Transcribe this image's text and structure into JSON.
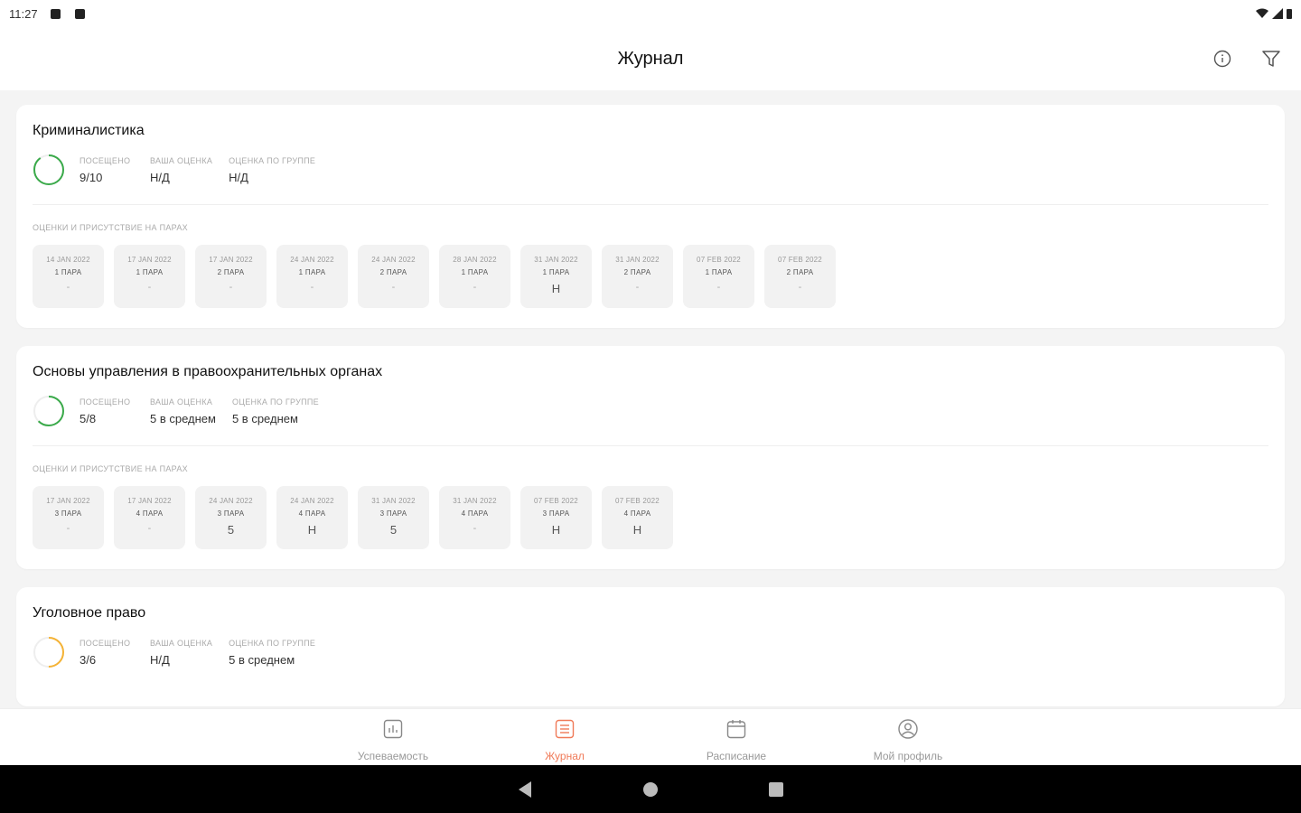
{
  "status_bar": {
    "time": "11:27"
  },
  "header": {
    "title": "Журнал",
    "info_icon": "info-icon",
    "filter_icon": "filter-icon"
  },
  "colors": {
    "accent": "#f07a58",
    "green": "#3aaa4a",
    "orange": "#f5b335"
  },
  "subjects": [
    {
      "title": "Криминалистика",
      "ring_color": "#3aaa4a",
      "attendance_fraction": 0.9,
      "stats": [
        {
          "label": "Посещено",
          "value": "9/10"
        },
        {
          "label": "Ваша оценка",
          "value": "Н/Д"
        },
        {
          "label": "Оценка по группе",
          "value": "Н/Д"
        }
      ],
      "section_label": "Оценки и присутствие на парах",
      "grades": [
        {
          "date": "14 JAN 2022",
          "pair": "1 ПАРА",
          "mark": "-"
        },
        {
          "date": "17 JAN 2022",
          "pair": "1 ПАРА",
          "mark": "-"
        },
        {
          "date": "17 JAN 2022",
          "pair": "2 ПАРА",
          "mark": "-"
        },
        {
          "date": "24 JAN 2022",
          "pair": "1 ПАРА",
          "mark": "-"
        },
        {
          "date": "24 JAN 2022",
          "pair": "2 ПАРА",
          "mark": "-"
        },
        {
          "date": "28 JAN 2022",
          "pair": "1 ПАРА",
          "mark": "-"
        },
        {
          "date": "31 JAN 2022",
          "pair": "1 ПАРА",
          "mark": "Н"
        },
        {
          "date": "31 JAN 2022",
          "pair": "2 ПАРА",
          "mark": "-"
        },
        {
          "date": "07 FEB 2022",
          "pair": "1 ПАРА",
          "mark": "-"
        },
        {
          "date": "07 FEB 2022",
          "pair": "2 ПАРА",
          "mark": "-"
        }
      ]
    },
    {
      "title": "Основы управления в правоохранительных органах",
      "ring_color": "#3aaa4a",
      "attendance_fraction": 0.625,
      "stats": [
        {
          "label": "Посещено",
          "value": "5/8"
        },
        {
          "label": "Ваша оценка",
          "value": "5 в среднем"
        },
        {
          "label": "Оценка по группе",
          "value": "5 в среднем"
        }
      ],
      "section_label": "Оценки и присутствие на парах",
      "grades": [
        {
          "date": "17 JAN 2022",
          "pair": "3 ПАРА",
          "mark": "-"
        },
        {
          "date": "17 JAN 2022",
          "pair": "4 ПАРА",
          "mark": "-"
        },
        {
          "date": "24 JAN 2022",
          "pair": "3 ПАРА",
          "mark": "5"
        },
        {
          "date": "24 JAN 2022",
          "pair": "4 ПАРА",
          "mark": "Н"
        },
        {
          "date": "31 JAN 2022",
          "pair": "3 ПАРА",
          "mark": "5"
        },
        {
          "date": "31 JAN 2022",
          "pair": "4 ПАРА",
          "mark": "-"
        },
        {
          "date": "07 FEB 2022",
          "pair": "3 ПАРА",
          "mark": "Н"
        },
        {
          "date": "07 FEB 2022",
          "pair": "4 ПАРА",
          "mark": "Н"
        }
      ]
    },
    {
      "title": "Уголовное право",
      "ring_color": "#f5b335",
      "attendance_fraction": 0.5,
      "stats": [
        {
          "label": "Посещено",
          "value": "3/6"
        },
        {
          "label": "Ваша оценка",
          "value": "Н/Д"
        },
        {
          "label": "Оценка по группе",
          "value": "5 в среднем"
        }
      ],
      "section_label": "",
      "grades": []
    }
  ],
  "bottom_nav": [
    {
      "label": "Успеваемость",
      "icon": "chart-icon",
      "active": false
    },
    {
      "label": "Журнал",
      "icon": "journal-icon",
      "active": true
    },
    {
      "label": "Расписание",
      "icon": "calendar-icon",
      "active": false
    },
    {
      "label": "Мой профиль",
      "icon": "profile-icon",
      "active": false
    }
  ]
}
